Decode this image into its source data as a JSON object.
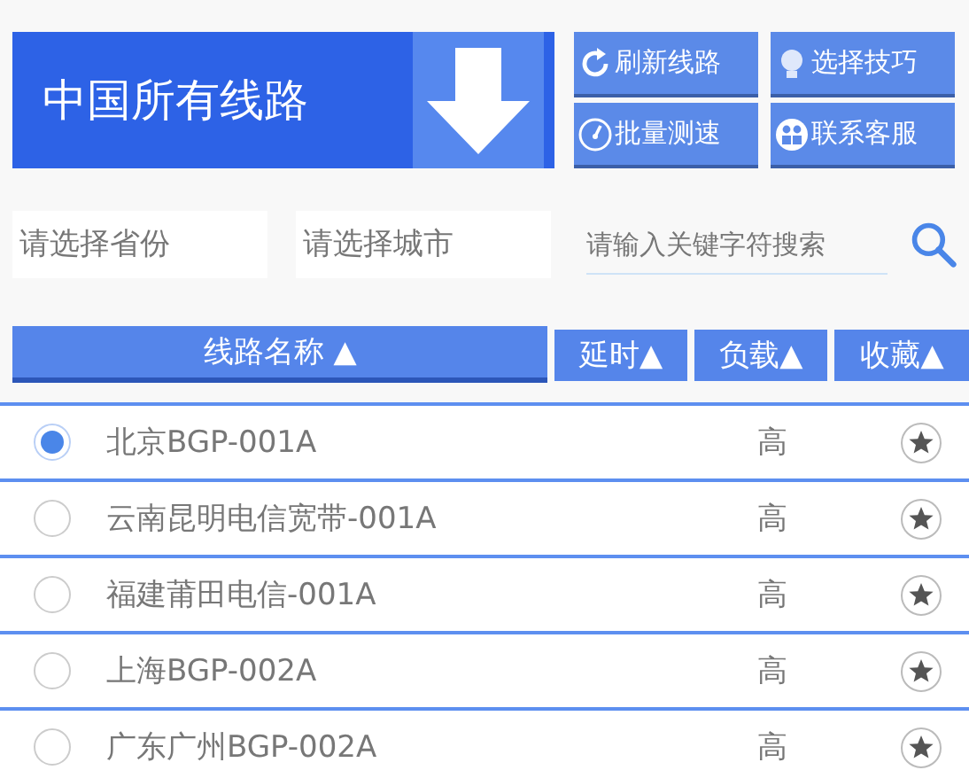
{
  "banner": {
    "title": "中国所有线路"
  },
  "buttons": [
    {
      "kind": "refresh",
      "label": "刷新线路"
    },
    {
      "kind": "tips",
      "label": "选择技巧"
    },
    {
      "kind": "speed",
      "label": "批量测速"
    },
    {
      "kind": "support",
      "label": "联系客服"
    }
  ],
  "filters": {
    "province": {
      "placeholder": "请选择省份"
    },
    "city": {
      "placeholder": "请选择城市"
    },
    "search": {
      "placeholder": "请输入关键字符搜索"
    }
  },
  "table": {
    "columns": [
      "线路名称 ▲",
      "延时▲",
      "负载▲",
      "收藏▲"
    ],
    "rows": [
      {
        "name": "北京BGP-001A",
        "load": "高",
        "selected": true
      },
      {
        "name": "云南昆明电信宽带-001A",
        "load": "高",
        "selected": false
      },
      {
        "name": "福建莆田电信-001A",
        "load": "高",
        "selected": false
      },
      {
        "name": "上海BGP-002A",
        "load": "高",
        "selected": false
      },
      {
        "name": "广东广州BGP-002A",
        "load": "高",
        "selected": false
      }
    ]
  }
}
